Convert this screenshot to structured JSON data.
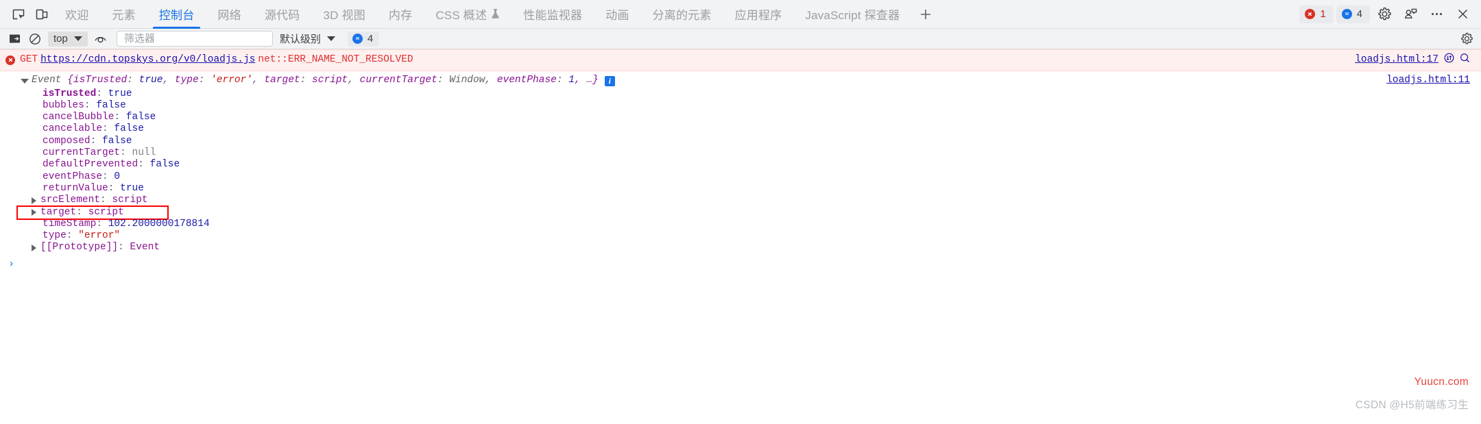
{
  "tabbar": {
    "left_icons": [
      {
        "name": "inspect-element-icon",
        "label": "检查元素"
      },
      {
        "name": "device-toolbar-icon",
        "label": "切换设备工具栏"
      }
    ],
    "tabs": [
      {
        "label": "欢迎",
        "active": false,
        "experimental": false
      },
      {
        "label": "元素",
        "active": false,
        "experimental": false
      },
      {
        "label": "控制台",
        "active": true,
        "experimental": false
      },
      {
        "label": "网络",
        "active": false,
        "experimental": false
      },
      {
        "label": "源代码",
        "active": false,
        "experimental": false
      },
      {
        "label": "3D 视图",
        "active": false,
        "experimental": false
      },
      {
        "label": "内存",
        "active": false,
        "experimental": false
      },
      {
        "label": "CSS 概述",
        "active": false,
        "experimental": true
      },
      {
        "label": "性能监视器",
        "active": false,
        "experimental": false
      },
      {
        "label": "动画",
        "active": false,
        "experimental": false
      },
      {
        "label": "分离的元素",
        "active": false,
        "experimental": false
      },
      {
        "label": "应用程序",
        "active": false,
        "experimental": false
      },
      {
        "label": "JavaScript 探查器",
        "active": false,
        "experimental": false
      }
    ],
    "add_tab_label": "+",
    "error_count": "1",
    "message_count": "4",
    "right_icons": [
      {
        "name": "settings-gear-icon",
        "label": "设置"
      },
      {
        "name": "feedback-icon",
        "label": "反馈"
      },
      {
        "name": "more-options-icon",
        "label": "更多选项"
      },
      {
        "name": "close-devtools-icon",
        "label": "关闭"
      }
    ]
  },
  "console_toolbar": {
    "sidebar_toggle": "console-sidebar-icon",
    "clear_console": "clear-console-icon",
    "context_value": "top",
    "eye_icon": "live-expression-icon",
    "filter_placeholder": "筛选器",
    "filter_value": "",
    "level_value": "默认级别",
    "message_count": "4",
    "settings_icon": "console-settings-icon"
  },
  "console": {
    "error_entry": {
      "method": "GET",
      "url": "https://cdn.topskys.org/v0/loadjs.js",
      "status": "net::ERR_NAME_NOT_RESOLVED",
      "source_link": "loadjs.html:17",
      "network_icon": "open-in-network-panel-icon",
      "search_icon": "search-icon"
    },
    "object_entry": {
      "class_name": "Event",
      "preview": [
        {
          "key": "isTrusted",
          "sep": ": ",
          "value": "true",
          "type": "bool"
        },
        {
          "key": "type",
          "sep": ": ",
          "value": "'error'",
          "type": "str"
        },
        {
          "key": "target",
          "sep": ": ",
          "value": "script",
          "type": "node"
        },
        {
          "key": "currentTarget",
          "sep": ": ",
          "value": "Window",
          "type": "win"
        },
        {
          "key": "eventPhase",
          "sep": ": ",
          "value": "1",
          "type": "num"
        }
      ],
      "ellipsis": ", …}",
      "info_badge": "i",
      "source_link": "loadjs.html:11",
      "properties": [
        {
          "key": "isTrusted",
          "value": "true",
          "type": "bool",
          "own": true,
          "expandable": false
        },
        {
          "key": "bubbles",
          "value": "false",
          "type": "bool",
          "own": false,
          "expandable": false
        },
        {
          "key": "cancelBubble",
          "value": "false",
          "type": "bool",
          "own": false,
          "expandable": false
        },
        {
          "key": "cancelable",
          "value": "false",
          "type": "bool",
          "own": false,
          "expandable": false
        },
        {
          "key": "composed",
          "value": "false",
          "type": "bool",
          "own": false,
          "expandable": false
        },
        {
          "key": "currentTarget",
          "value": "null",
          "type": "null",
          "own": false,
          "expandable": false
        },
        {
          "key": "defaultPrevented",
          "value": "false",
          "type": "bool",
          "own": false,
          "expandable": false
        },
        {
          "key": "eventPhase",
          "value": "0",
          "type": "num",
          "own": false,
          "expandable": false
        },
        {
          "key": "returnValue",
          "value": "true",
          "type": "bool",
          "own": false,
          "expandable": false
        },
        {
          "key": "srcElement",
          "value": "script",
          "type": "node",
          "own": false,
          "expandable": true
        },
        {
          "key": "target",
          "value": "script",
          "type": "node",
          "own": false,
          "expandable": true,
          "highlighted": true
        },
        {
          "key": "timeStamp",
          "value": "102.2000000178814",
          "type": "num",
          "own": false,
          "expandable": false
        },
        {
          "key": "type",
          "value": "\"error\"",
          "type": "str",
          "own": false,
          "expandable": false
        },
        {
          "key": "[[Prototype]]",
          "value": "Event",
          "type": "node",
          "own": false,
          "expandable": true
        }
      ]
    },
    "prompt_symbol": "›"
  },
  "watermarks": {
    "primary": "Yuucn.com",
    "secondary": "CSDN @H5前端练习生"
  }
}
